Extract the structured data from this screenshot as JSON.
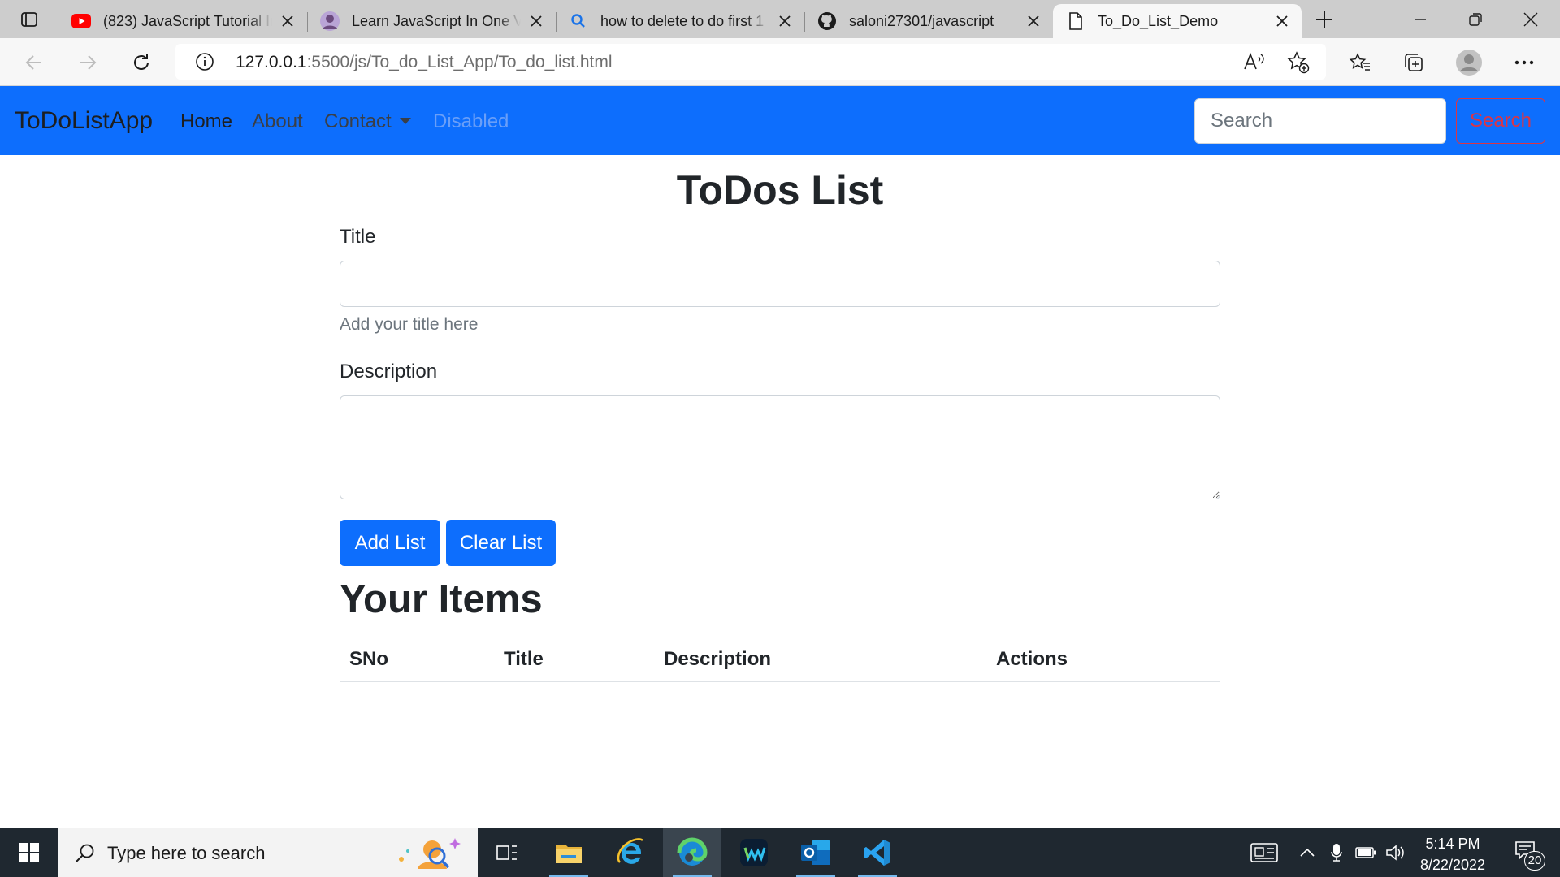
{
  "browser": {
    "tabs": [
      {
        "title": "(823) JavaScript Tutorial In Hindi",
        "icon": "youtube-icon"
      },
      {
        "title": "Learn JavaScript In One Video",
        "icon": "avatar-icon"
      },
      {
        "title": "how to delete to do first 1",
        "icon": "search-icon"
      },
      {
        "title": "saloni27301/javascript",
        "icon": "github-icon"
      },
      {
        "title": "To_Do_List_Demo",
        "icon": "page-icon",
        "active": true
      }
    ],
    "url_host": "127.0.0.1",
    "url_rest": ":5500/js/To_do_List_App/To_do_list.html"
  },
  "navbar": {
    "brand": "ToDoListApp",
    "links": {
      "home": "Home",
      "about": "About",
      "contact": "Contact",
      "disabled": "Disabled"
    },
    "search_placeholder": "Search",
    "search_button": "Search",
    "bg_color": "#0d6efd"
  },
  "main": {
    "title": "ToDos List",
    "title_label": "Title",
    "title_value": "",
    "title_help": "Add your title here",
    "description_label": "Description",
    "description_value": "",
    "add_button": "Add List",
    "clear_button": "Clear List",
    "items_heading": "Your Items",
    "table_headers": {
      "sno": "SNo",
      "title": "Title",
      "description": "Description",
      "actions": "Actions"
    },
    "table_rows": []
  },
  "taskbar": {
    "search_placeholder": "Type here to search",
    "time": "5:14 PM",
    "date": "8/22/2022",
    "notification_count": "20"
  }
}
